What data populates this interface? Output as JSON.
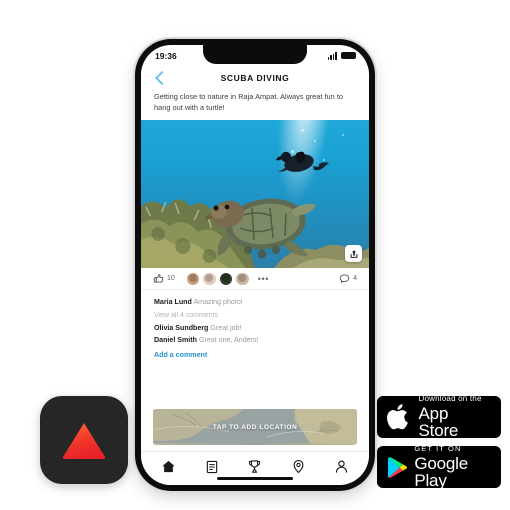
{
  "phone": {
    "status_bar": {
      "time": "19:36",
      "signal_icon": "signal-bars-icon",
      "battery_icon": "battery-icon"
    },
    "nav": {
      "back_icon": "back-chevron-icon",
      "title": "SCUBA DIVING"
    },
    "post": {
      "caption": "Getting close to nature in Raja Ampat. Always great fun to hang out with a turtle!",
      "photo_alt": "scuba diver swimming above a sea turtle on a coral reef",
      "share_icon": "share-icon"
    },
    "actions": {
      "like_icon": "thumbs-up-icon",
      "like_count": "10",
      "overflow_label": "•••",
      "comment_icon": "speech-bubble-icon",
      "comment_count": "4",
      "avatar_label": "avatar"
    },
    "comments": {
      "items": [
        {
          "name": "Maria Lund",
          "text": "Amazing photo!"
        },
        {
          "name": "Olivia Sundberg",
          "text": "Great job!"
        },
        {
          "name": "Daniel Smith",
          "text": "Great one, Anders!"
        }
      ],
      "view_all": "View all 4 comments",
      "add_comment": "Add a comment"
    },
    "map_card": {
      "label": "TAP TO ADD LOCATION"
    },
    "tabbar": {
      "items": [
        {
          "name": "home",
          "icon": "home-icon"
        },
        {
          "name": "feed",
          "icon": "list-icon"
        },
        {
          "name": "trophy",
          "icon": "trophy-icon"
        },
        {
          "name": "places",
          "icon": "location-pin-icon"
        },
        {
          "name": "profile",
          "icon": "person-icon"
        }
      ]
    }
  },
  "app_icon": {
    "name": "app-logo",
    "glyph": "triangle-icon"
  },
  "badges": {
    "app_store": {
      "small": "Download on the",
      "big": "App Store",
      "icon": "apple-icon"
    },
    "google_play": {
      "small": "GET IT ON",
      "big": "Google Play",
      "icon": "google-play-icon"
    }
  },
  "colors": {
    "link": "#2593d6",
    "back_chevron": "#6fc4e8",
    "accent_red": "#f0392b",
    "water": "#1fa8d8"
  }
}
